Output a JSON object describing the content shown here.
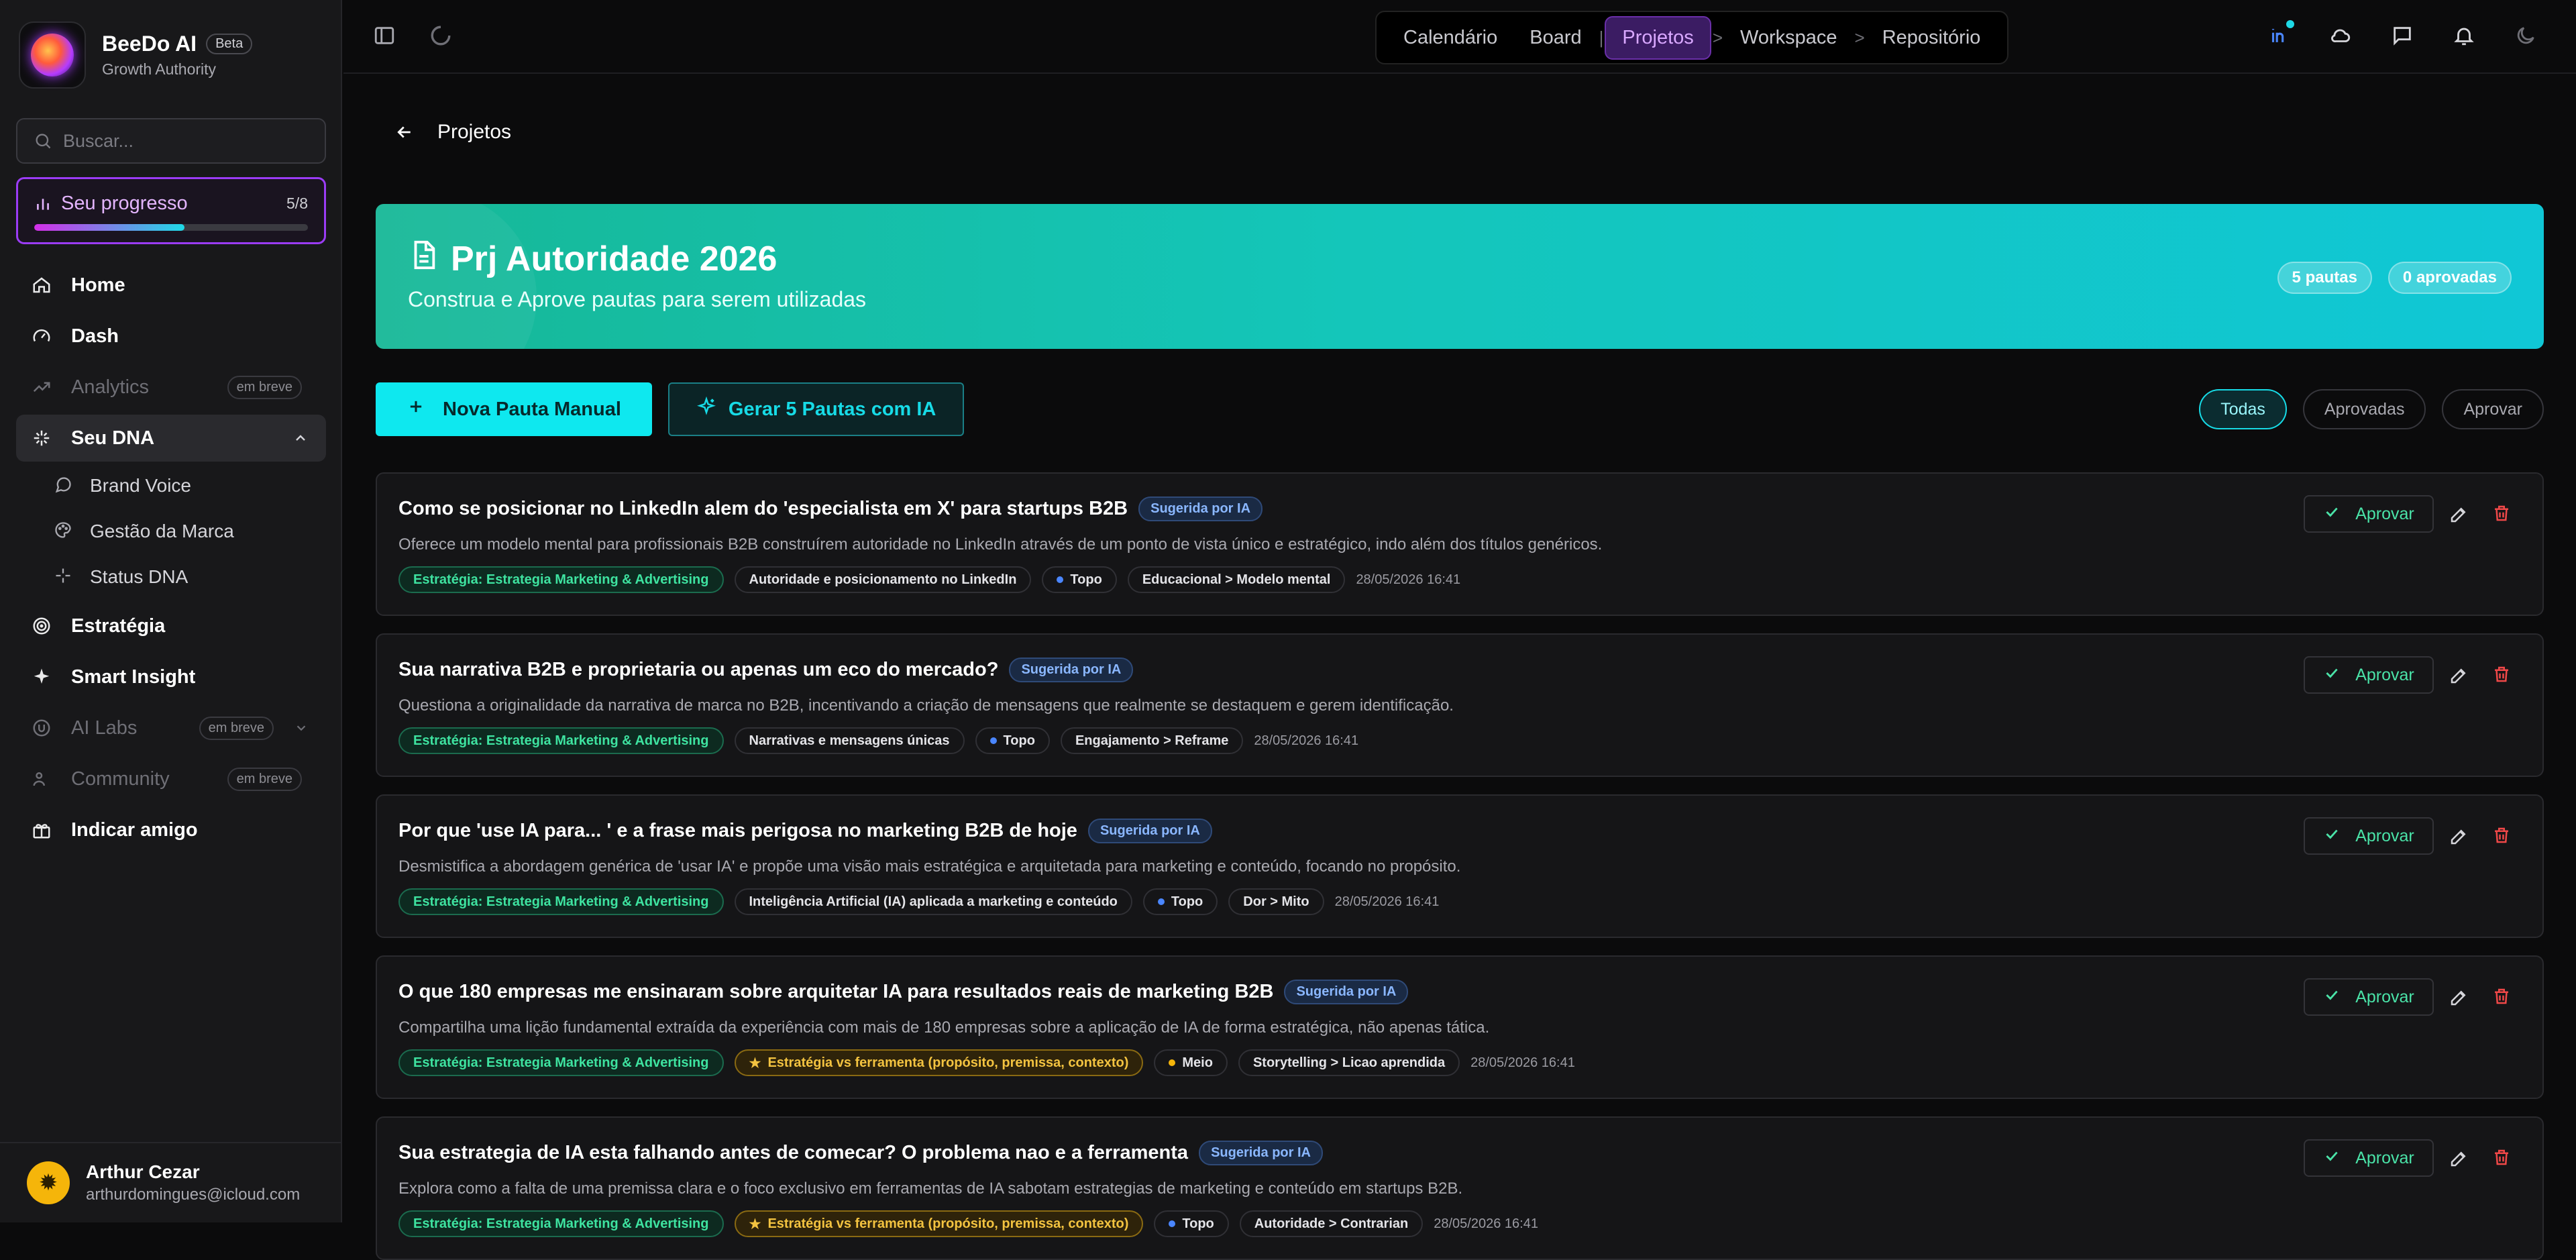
{
  "brand": {
    "name": "BeeDo AI",
    "badge": "Beta",
    "subtitle": "Growth Authority"
  },
  "search": {
    "placeholder": "Buscar..."
  },
  "progress": {
    "label": "Seu progresso",
    "count": "5/8",
    "fraction": 0.55
  },
  "nav": {
    "home": "Home",
    "dash": "Dash",
    "analytics": "Analytics",
    "analytics_badge": "em breve",
    "dna": "Seu DNA",
    "dna_items": [
      "Brand Voice",
      "Gestão da Marca",
      "Status DNA"
    ],
    "estrategia": "Estratégia",
    "smart_insight": "Smart Insight",
    "ai_labs": "AI Labs",
    "ai_labs_badge": "em breve",
    "community": "Community",
    "community_badge": "em breve",
    "indicar": "Indicar amigo"
  },
  "user": {
    "name": "Arthur Cezar",
    "email": "arthurdomingues@icloud.com"
  },
  "breadcrumbs": [
    "Calendário",
    "Board",
    "Projetos",
    "Workspace",
    "Repositório"
  ],
  "page": {
    "back_label": "Projetos"
  },
  "hero": {
    "title": "Prj Autoridade 2026",
    "subtitle": "Construa e Aprove pautas para serem utilizadas",
    "pautas": "5 pautas",
    "aprovadas": "0 aprovadas"
  },
  "actions": {
    "manual": "Nova Pauta Manual",
    "ia": "Gerar 5 Pautas com IA"
  },
  "filters": [
    "Todas",
    "Aprovadas",
    "Aprovar"
  ],
  "ia_badge": "Sugerida por IA",
  "approve_label": "Aprovar",
  "colors": {
    "accent": "#0ee8ef",
    "purple": "#9b3cf6",
    "green": "#3ee3a0",
    "delete": "#f04848",
    "topo": "#4a86ff",
    "meio": "#f5b50a"
  },
  "cards": [
    {
      "title": "Como se posicionar no LinkedIn alem do 'especialista em X' para startups B2B",
      "desc": "Oferece um modelo mental para profissionais B2B construírem autoridade no LinkedIn através de um ponto de vista único e estratégico, indo além dos títulos genéricos.",
      "strategy": "Estratégia: Estrategia Marketing & Advertising",
      "special": "",
      "topic": "Autoridade e posicionamento no LinkedIn",
      "stage": "Topo",
      "stage_color": "#4a86ff",
      "format": "Educacional > Modelo mental",
      "date": "28/05/2026 16:41"
    },
    {
      "title": "Sua narrativa B2B e proprietaria ou apenas um eco do mercado?",
      "desc": "Questiona a originalidade da narrativa de marca no B2B, incentivando a criação de mensagens que realmente se destaquem e gerem identificação.",
      "strategy": "Estratégia: Estrategia Marketing & Advertising",
      "special": "",
      "topic": "Narrativas e mensagens únicas",
      "stage": "Topo",
      "stage_color": "#4a86ff",
      "format": "Engajamento > Reframe",
      "date": "28/05/2026 16:41"
    },
    {
      "title": "Por que 'use IA para... ' e a frase mais perigosa no marketing B2B de hoje",
      "desc": "Desmistifica a abordagem genérica de 'usar IA' e propõe uma visão mais estratégica e arquitetada para marketing e conteúdo, focando no propósito.",
      "strategy": "Estratégia: Estrategia Marketing & Advertising",
      "special": "",
      "topic": "Inteligência Artificial (IA) aplicada a marketing e conteúdo",
      "stage": "Topo",
      "stage_color": "#4a86ff",
      "format": "Dor > Mito",
      "date": "28/05/2026 16:41"
    },
    {
      "title": "O que 180 empresas me ensinaram sobre arquitetar IA para resultados reais de marketing B2B",
      "desc": "Compartilha uma lição fundamental extraída da experiência com mais de 180 empresas sobre a aplicação de IA de forma estratégica, não apenas tática.",
      "strategy": "Estratégia: Estrategia Marketing & Advertising",
      "special": "Estratégia vs ferramenta (propósito, premissa, contexto)",
      "topic": "",
      "stage": "Meio",
      "stage_color": "#f5b50a",
      "format": "Storytelling > Licao aprendida",
      "date": "28/05/2026 16:41"
    },
    {
      "title": "Sua estrategia de IA esta falhando antes de comecar? O problema nao e a ferramenta",
      "desc": "Explora como a falta de uma premissa clara e o foco exclusivo em ferramentas de IA sabotam estrategias de marketing e conteúdo em startups B2B.",
      "strategy": "Estratégia: Estrategia Marketing & Advertising",
      "special": "Estratégia vs ferramenta (propósito, premissa, contexto)",
      "topic": "",
      "stage": "Topo",
      "stage_color": "#4a86ff",
      "format": "Autoridade > Contrarian",
      "date": "28/05/2026 16:41"
    }
  ]
}
